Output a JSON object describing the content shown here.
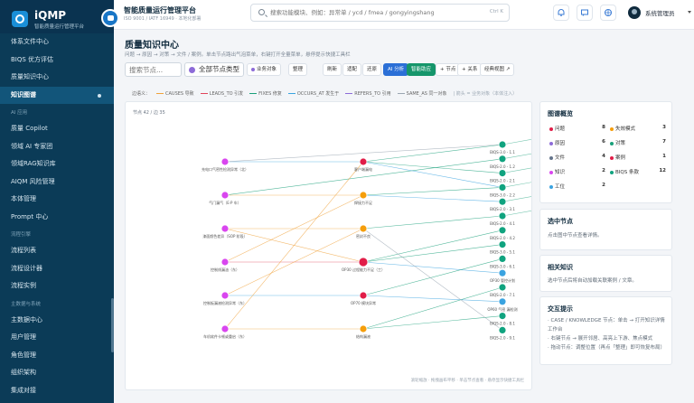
{
  "brand": {
    "name": "iQMP",
    "sub": "智能质量运行管理平台"
  },
  "sidebar": {
    "items": [
      {
        "label": "体系文件中心",
        "type": "item"
      },
      {
        "label": "BIQS 优方评估",
        "type": "item"
      },
      {
        "label": "质量知识中心",
        "type": "item"
      },
      {
        "label": "知识图谱",
        "type": "item",
        "active": true
      },
      {
        "label": "AI 应用",
        "type": "group"
      },
      {
        "label": "质量 Copilot",
        "type": "item"
      },
      {
        "label": "领域 AI 专家团",
        "type": "item"
      },
      {
        "label": "领域RAG知识库",
        "type": "item"
      },
      {
        "label": "AIQM 风险管理",
        "type": "item"
      },
      {
        "label": "本体管理",
        "type": "item"
      },
      {
        "label": "Prompt 中心",
        "type": "item"
      },
      {
        "label": "流程引擎",
        "type": "group"
      },
      {
        "label": "流程列表",
        "type": "item"
      },
      {
        "label": "流程设计器",
        "type": "item"
      },
      {
        "label": "流程实例",
        "type": "item"
      },
      {
        "label": "主数据与系统",
        "type": "group"
      },
      {
        "label": "主数据中心",
        "type": "item"
      },
      {
        "label": "用户管理",
        "type": "item"
      },
      {
        "label": "角色管理",
        "type": "item"
      },
      {
        "label": "组织架构",
        "type": "item"
      },
      {
        "label": "集成对接",
        "type": "item"
      }
    ]
  },
  "header": {
    "title": "智能质量运行管理平台",
    "subtitle": "ISO 9001 / IATF 16949 · 本地化部署",
    "search_placeholder": "搜索功能模块、例如：异常单 / ycd / fmea / gongyingshang",
    "search_shortcut": "Ctrl K",
    "user_name": "系统管理员",
    "icons": [
      "bell-icon",
      "message-icon",
      "globe-icon"
    ]
  },
  "page": {
    "title": "质量知识中心",
    "description": "问题 → 原因 → 对策 → 文件 / 案例。单击节点路出气泡菜单，右键打开全量菜单，悬停提示快捷工具栏",
    "toolbar": {
      "search_placeholder": "搜索节点...",
      "select_value": "全部节点类型",
      "buttons": [
        {
          "label": "业务对象",
          "style": "plain",
          "dot": "#8d6bd8"
        },
        {
          "label": "整理",
          "style": "plain",
          "dot": ""
        },
        {
          "label": "刷新",
          "style": "plain",
          "dot": ""
        },
        {
          "label": "适配",
          "style": "plain",
          "dot": ""
        },
        {
          "label": "还原",
          "style": "plain",
          "dot": ""
        },
        {
          "label": "AI 分析",
          "style": "blue",
          "dot": ""
        },
        {
          "label": "智能助应",
          "style": "green",
          "dot": ""
        },
        {
          "label": "+ 节点",
          "style": "plain",
          "dot": ""
        },
        {
          "label": "+ 关系",
          "style": "plain",
          "dot": ""
        },
        {
          "label": "经典视图 ↗",
          "style": "plain",
          "dot": ""
        }
      ]
    },
    "legend": {
      "title": "边语义：",
      "items": [
        {
          "label": "CAUSES 导致",
          "color": "#f0a23a"
        },
        {
          "label": "LEADS_TO 引发",
          "color": "#e0445a"
        },
        {
          "label": "FIXES 修复",
          "color": "#19a07a"
        },
        {
          "label": "OCCURS_AT 发生于",
          "color": "#3aa3e0"
        },
        {
          "label": "REFERS_TO 引用",
          "color": "#8d6bd8"
        },
        {
          "label": "SAME_AS 同一对象",
          "color": "#9aa6b2"
        }
      ],
      "note": "| 箭头 = 业务对象（本体注入）"
    },
    "graph": {
      "count": "节点 42 / 边 35",
      "footnote": "滚轮缩放 · 拖拽画布平移 · 单击节点查看 · 悬停显示快捷工具栏",
      "nodes": [
        {
          "label": "充电口气密性检测异常（北）",
          "color": "#d946ef",
          "col": 0,
          "row": 0
        },
        {
          "label": "气门漏气（E·P 车）",
          "color": "#d946ef",
          "col": 0,
          "row": 1
        },
        {
          "label": "漆面颜色差异（SOP 阶段）",
          "color": "#d946ef",
          "col": 0,
          "row": 2
        },
        {
          "label": "控制线漏油（东）",
          "color": "#d946ef",
          "col": 0,
          "row": 3
        },
        {
          "label": "控制板漏液检测异常（东）",
          "color": "#d946ef",
          "col": 0,
          "row": 4
        },
        {
          "label": "车机软件卡顿或重启（东）",
          "color": "#d946ef",
          "col": 0,
          "row": 5
        },
        {
          "label": "客户端漏电",
          "color": "#e11d48",
          "col": 1,
          "row": 0
        },
        {
          "label": "焊接力不足",
          "color": "#f59e0b",
          "col": 1,
          "row": 1
        },
        {
          "label": "密封不良",
          "color": "#f59e0b",
          "col": 1,
          "row": 2
        },
        {
          "label": "OP30 过程能力不足（工）",
          "color": "#e11d48",
          "col": 1,
          "row": 3
        },
        {
          "label": "OP70 模块异常",
          "color": "#e11d48",
          "col": 1,
          "row": 4
        },
        {
          "label": "结构漏液",
          "color": "#f59e0b",
          "col": 1,
          "row": 5
        },
        {
          "label": "BIQS-3.0 - 1.1",
          "color": "#10a37f",
          "col": 2,
          "row": 0
        },
        {
          "label": "BIQS-2.0 - 1.2",
          "color": "#10a37f",
          "col": 2,
          "row": 1
        },
        {
          "label": "BIQS-2.0 - 2.1",
          "color": "#10a37f",
          "col": 2,
          "row": 2
        },
        {
          "label": "BIQS-3.0 - 2.2",
          "color": "#10a37f",
          "col": 2,
          "row": 3
        },
        {
          "label": "BIQS-2.0 - 3.1",
          "color": "#10a37f",
          "col": 2,
          "row": 4
        },
        {
          "label": "BIQS-2.0 - 4.1",
          "color": "#10a37f",
          "col": 2,
          "row": 5
        },
        {
          "label": "BIQS-2.0 - 4.2",
          "color": "#10a37f",
          "col": 2,
          "row": 6
        },
        {
          "label": "BIQS-3.0 - 5.1",
          "color": "#10a37f",
          "col": 2,
          "row": 7
        },
        {
          "label": "BIQS-3.0 - 6.1",
          "color": "#10a37f",
          "col": 2,
          "row": 8
        },
        {
          "label": "OP30 管控计划",
          "color": "#3aa3e0",
          "col": 2,
          "row": 9
        },
        {
          "label": "BIQS-2.0 - 7.1",
          "color": "#10a37f",
          "col": 2,
          "row": 10
        },
        {
          "label": "OP60 气密 漏检测",
          "color": "#3aa3e0",
          "col": 2,
          "row": 11
        },
        {
          "label": "BIQS-2.0 - 8.1",
          "color": "#10a37f",
          "col": 2,
          "row": 12
        },
        {
          "label": "BIQS-2.0 - 9.1",
          "color": "#10a37f",
          "col": 2,
          "row": 13
        }
      ]
    },
    "overview": {
      "title": "图谱概览",
      "stats": [
        {
          "label": "问题",
          "value": "8",
          "color": "#e11d48"
        },
        {
          "label": "失效模式",
          "value": "3",
          "color": "#f59e0b"
        },
        {
          "label": "原因",
          "value": "6",
          "color": "#8d6bd8"
        },
        {
          "label": "对策",
          "value": "7",
          "color": "#19a07a"
        },
        {
          "label": "文件",
          "value": "4",
          "color": "#64748b"
        },
        {
          "label": "案例",
          "value": "1",
          "color": "#e11d48"
        },
        {
          "label": "知识",
          "value": "2",
          "color": "#d946ef"
        },
        {
          "label": "BIQS 条款",
          "value": "12",
          "color": "#10a37f"
        },
        {
          "label": "工位",
          "value": "2",
          "color": "#3aa3e0"
        }
      ]
    },
    "selected": {
      "title": "选中节点",
      "text": "点击图中节点查看详情。"
    },
    "related": {
      "title": "相关知识",
      "text": "选中节点后将自动加载关联案例 / 文章。"
    },
    "tips": {
      "title": "交互提示",
      "lines": [
        "· CASE / KNOWLEDGE 节点：单击 → 打开知识详情工作台",
        "· 右键节点 → 展开邻居、高亮上下游、焦点模式",
        "· 拖动节点：调整位置（再点「整理」即可恢复布局）"
      ]
    }
  }
}
